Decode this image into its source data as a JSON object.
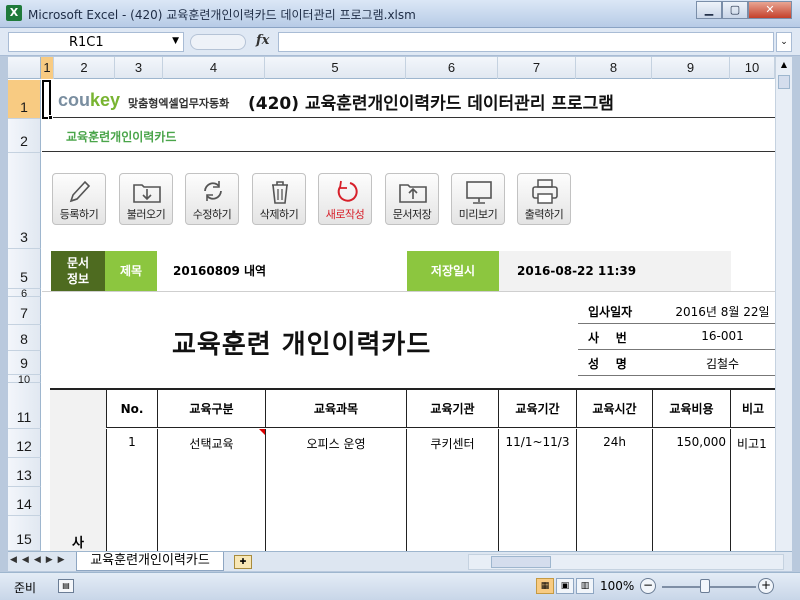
{
  "window": {
    "title": "Microsoft Excel - (420) 교육훈련개인이력카드 데이터관리 프로그램.xlsm",
    "app_icon": "X",
    "controls": {
      "minimize": "▁",
      "maximize": "▢",
      "close": "✕"
    }
  },
  "formula_bar": {
    "name_box": "R1C1",
    "fx": "fx",
    "formula": ""
  },
  "columns": [
    "1",
    "2",
    "3",
    "4",
    "5",
    "6",
    "7",
    "8",
    "9",
    "10"
  ],
  "rows": [
    "1",
    "2",
    "3",
    "5",
    "6",
    "7",
    "8",
    "9",
    "10",
    "11",
    "12",
    "13",
    "14",
    "15"
  ],
  "sheet": {
    "logo_main": "cou",
    "logo_accent": "key",
    "logo_sub": "맞춤형엑셀업무자동화",
    "title": "(420) 교육훈련개인이력카드 데이터관리 프로그램",
    "subtitle": "교육훈련개인이력카드"
  },
  "toolbar": [
    {
      "label": "등록하기",
      "icon": "pencil-icon"
    },
    {
      "label": "불러오기",
      "icon": "folder-download-icon"
    },
    {
      "label": "수정하기",
      "icon": "refresh-icon"
    },
    {
      "label": "삭제하기",
      "icon": "trash-icon"
    },
    {
      "label": "새로작성",
      "icon": "reset-icon",
      "color": "#d7202a"
    },
    {
      "label": "문서저장",
      "icon": "folder-upload-icon"
    },
    {
      "label": "미리보기",
      "icon": "monitor-icon"
    },
    {
      "label": "출력하기",
      "icon": "printer-icon"
    }
  ],
  "doc_info": {
    "label": "문서\n정보",
    "title_label": "제목",
    "title_value": "20160809 내역",
    "saved_label": "저장일시",
    "saved_value": "2016-08-22 11:39"
  },
  "card": {
    "heading": "교육훈련 개인이력카드",
    "fields": [
      {
        "key": "입사일자",
        "value": "2016년 8월 22일"
      },
      {
        "key": "사    번",
        "value": "16-001"
      },
      {
        "key": "성    명",
        "value": "김철수"
      }
    ],
    "side_label": "사",
    "table_headers": [
      "No.",
      "교육구분",
      "교육과목",
      "교육기관",
      "교육기간",
      "교육시간",
      "교육비용",
      "비고"
    ],
    "table_rows": [
      [
        "1",
        "선택교육",
        "오피스 운영",
        "쿠키센터",
        "11/1~11/3",
        "24h",
        "150,000",
        "비고1"
      ]
    ]
  },
  "sheet_tabs": {
    "active": "교육훈련개인이력카드",
    "nav": "◀◀◀▶▶"
  },
  "status": {
    "ready": "준비",
    "zoom": "100%",
    "zoom_minus": "−",
    "zoom_plus": "+"
  },
  "colors": {
    "accent_green": "#8cc63f",
    "dark_green": "#4e6b20",
    "subtitle_green": "#4aa54a",
    "red": "#d7202a",
    "excel_blue": "#b9c9dd"
  }
}
